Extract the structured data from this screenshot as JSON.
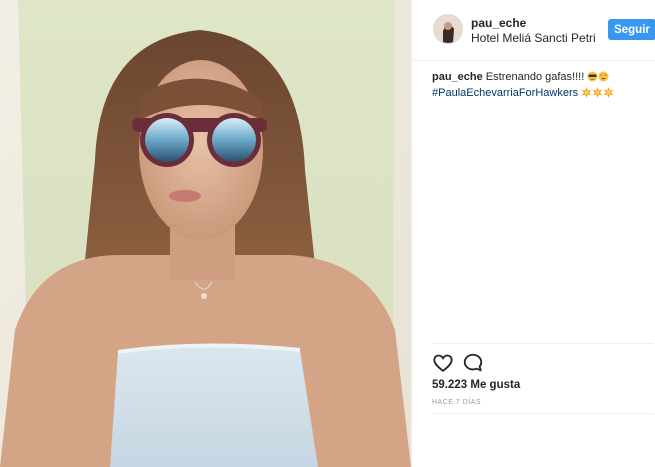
{
  "post": {
    "username": "pau_eche",
    "location": "Hotel Meliá Sancti Petri",
    "follow_label": "Seguir",
    "caption_user": "pau_eche",
    "caption_text": " Estrenando gafas!!!! ",
    "caption_hashtag": "#PaulaEchevarriaForHawkers",
    "likes": "59.223 Me gusta",
    "timestamp": "HACE 7 DÍAS"
  },
  "icons": {
    "like": "heart-icon",
    "comment": "comment-icon"
  },
  "colors": {
    "follow_button": "#3897f0",
    "hashtag": "#003569",
    "divider": "#efefef",
    "timestamp": "#999999"
  }
}
